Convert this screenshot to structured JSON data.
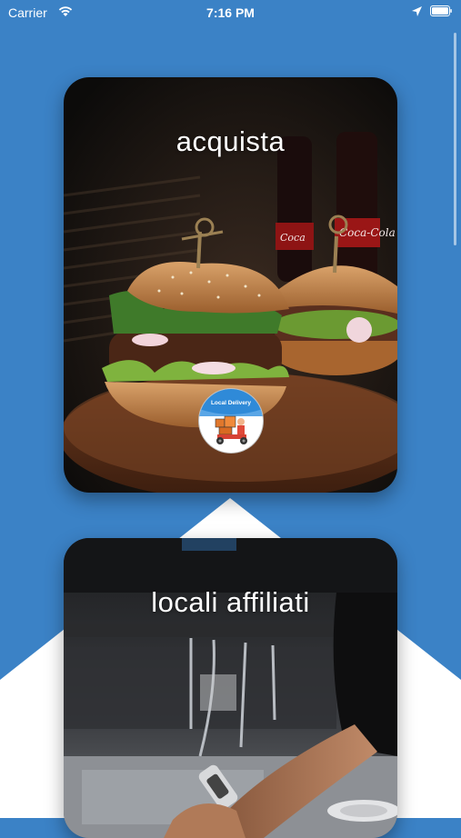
{
  "status_bar": {
    "carrier": "Carrier",
    "time": "7:16 PM"
  },
  "cards": [
    {
      "title": "acquista",
      "badge": {
        "label": "Local Delivery"
      }
    },
    {
      "title": "locali affiliati"
    }
  ],
  "colors": {
    "background": "#3b82c6",
    "accent_white": "#ffffff"
  },
  "icons": [
    "wifi-icon",
    "location-arrow-icon",
    "battery-icon",
    "delivery-scooter-icon"
  ]
}
